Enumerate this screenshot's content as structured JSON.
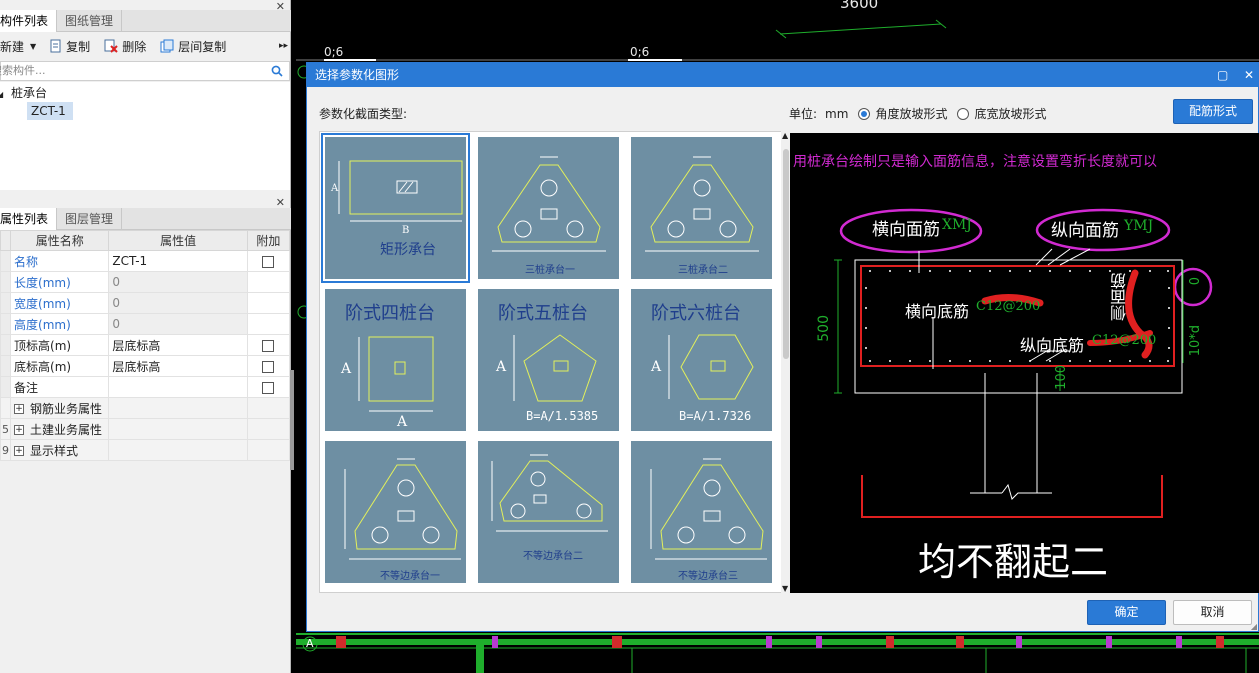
{
  "left_panel": {
    "top_tabs": [
      "构件列表",
      "图纸管理"
    ],
    "toolbar": {
      "new": "新建",
      "copy": "复制",
      "delete": "删除",
      "floor_copy": "层间复制"
    },
    "search_placeholder": "搜索构件...",
    "tree": {
      "root": "桩承台",
      "child": "ZCT-1"
    },
    "prop_tabs": [
      "属性列表",
      "图层管理"
    ],
    "prop_headers": {
      "name": "属性名称",
      "value": "属性值",
      "extra": "附加"
    },
    "rows": [
      {
        "num": "",
        "name": "名称",
        "value": "ZCT-1"
      },
      {
        "num": "",
        "name": "长度(mm)",
        "value": "0"
      },
      {
        "num": "",
        "name": "宽度(mm)",
        "value": "0"
      },
      {
        "num": "",
        "name": "高度(mm)",
        "value": "0"
      },
      {
        "num": "",
        "name": "顶标高(m)",
        "value": "层底标高"
      },
      {
        "num": "",
        "name": "底标高(m)",
        "value": "层底标高"
      },
      {
        "num": "",
        "name": "备注",
        "value": ""
      },
      {
        "num": "",
        "name": "钢筋业务属性",
        "value": ""
      },
      {
        "num": "5",
        "name": "土建业务属性",
        "value": ""
      },
      {
        "num": "9",
        "name": "显示样式",
        "value": ""
      }
    ]
  },
  "cad": {
    "dim_3600": "3600",
    "axis_label_1": "0;6",
    "axis_label_2": "0;6",
    "axis_a": "A"
  },
  "dialog": {
    "title": "选择参数化图形",
    "type_label": "参数化截面类型:",
    "unit_label": "单位:",
    "unit_value": "mm",
    "radio_angle": "角度放坡形式",
    "radio_width": "底宽放坡形式",
    "rebar_button": "配筋形式",
    "ok": "确定",
    "cancel": "取消",
    "thumbs": [
      {
        "label": "矩形承台"
      },
      {
        "label": "三桩承台一"
      },
      {
        "label": "三桩承台二"
      },
      {
        "label": "阶式四桩台",
        "formula": ""
      },
      {
        "label": "阶式五桩台",
        "formula": "B=A/1.5385"
      },
      {
        "label": "阶式六桩台",
        "formula": "B=A/1.7326"
      },
      {
        "label": "不等边承台一"
      },
      {
        "label": "不等边承台二"
      },
      {
        "label": "不等边承台三"
      }
    ],
    "preview": {
      "hint": "用桩承台绘制只是输入面筋信息，注意设置弯折长度就可以",
      "h_top": "横向面筋",
      "h_top_code": "XMJ",
      "v_top": "纵向面筋",
      "v_top_code": "YMJ",
      "h_bottom": "横向底筋",
      "h_bottom_code": "C12@200",
      "v_bottom": "纵向底筋",
      "v_bottom_code": "C12@200",
      "side": "侧面筋",
      "dim_500": "500",
      "dim_100": "100",
      "dim_0": "0",
      "dim_10d": "10*d",
      "handwritten": "均不翻起二"
    }
  }
}
